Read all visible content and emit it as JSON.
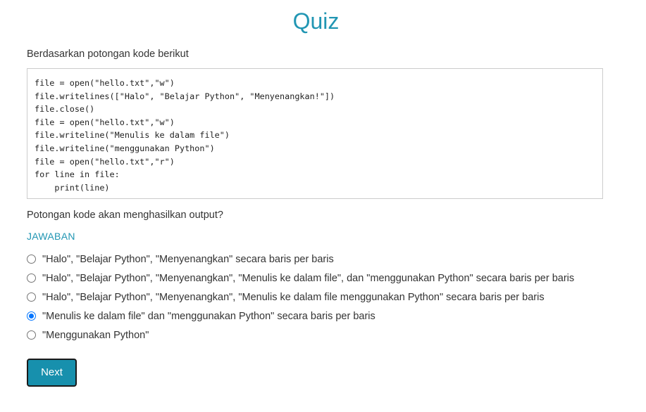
{
  "quiz": {
    "title": "Quiz",
    "prompt": "Berdasarkan potongan kode berikut",
    "code_lines": [
      "file = open(\"hello.txt\",\"w\")",
      "file.writelines([\"Halo\", \"Belajar Python\", \"Menyenangkan!\"])",
      "file.close()",
      "file = open(\"hello.txt\",\"w\")",
      "file.writeline(\"Menulis ke dalam file\")",
      "file.writeline(\"menggunakan Python\")",
      "file = open(\"hello.txt\",\"r\")",
      "for line in file:",
      "    print(line)"
    ],
    "question": "Potongan kode akan menghasilkan output?",
    "answer_heading": "JAWABAN",
    "options": [
      {
        "label": "\"Halo\", \"Belajar Python\", \"Menyenangkan\" secara baris per baris",
        "selected": false
      },
      {
        "label": "\"Halo\", \"Belajar Python\", \"Menyenangkan\", \"Menulis ke dalam file\", dan \"menggunakan Python\" secara baris per baris",
        "selected": false
      },
      {
        "label": "\"Halo\", \"Belajar Python\", \"Menyenangkan\", \"Menulis ke dalam file menggunakan Python\" secara baris per baris",
        "selected": false
      },
      {
        "label": "\"Menulis ke dalam file\" dan \"menggunakan Python\" secara baris per baris",
        "selected": true
      },
      {
        "label": "\"Menggunakan Python\"",
        "selected": false
      }
    ],
    "next_label": "Next"
  },
  "colors": {
    "accent": "#2196b3",
    "button_bg": "#1790ad",
    "radio_checked": "#0075ff"
  }
}
